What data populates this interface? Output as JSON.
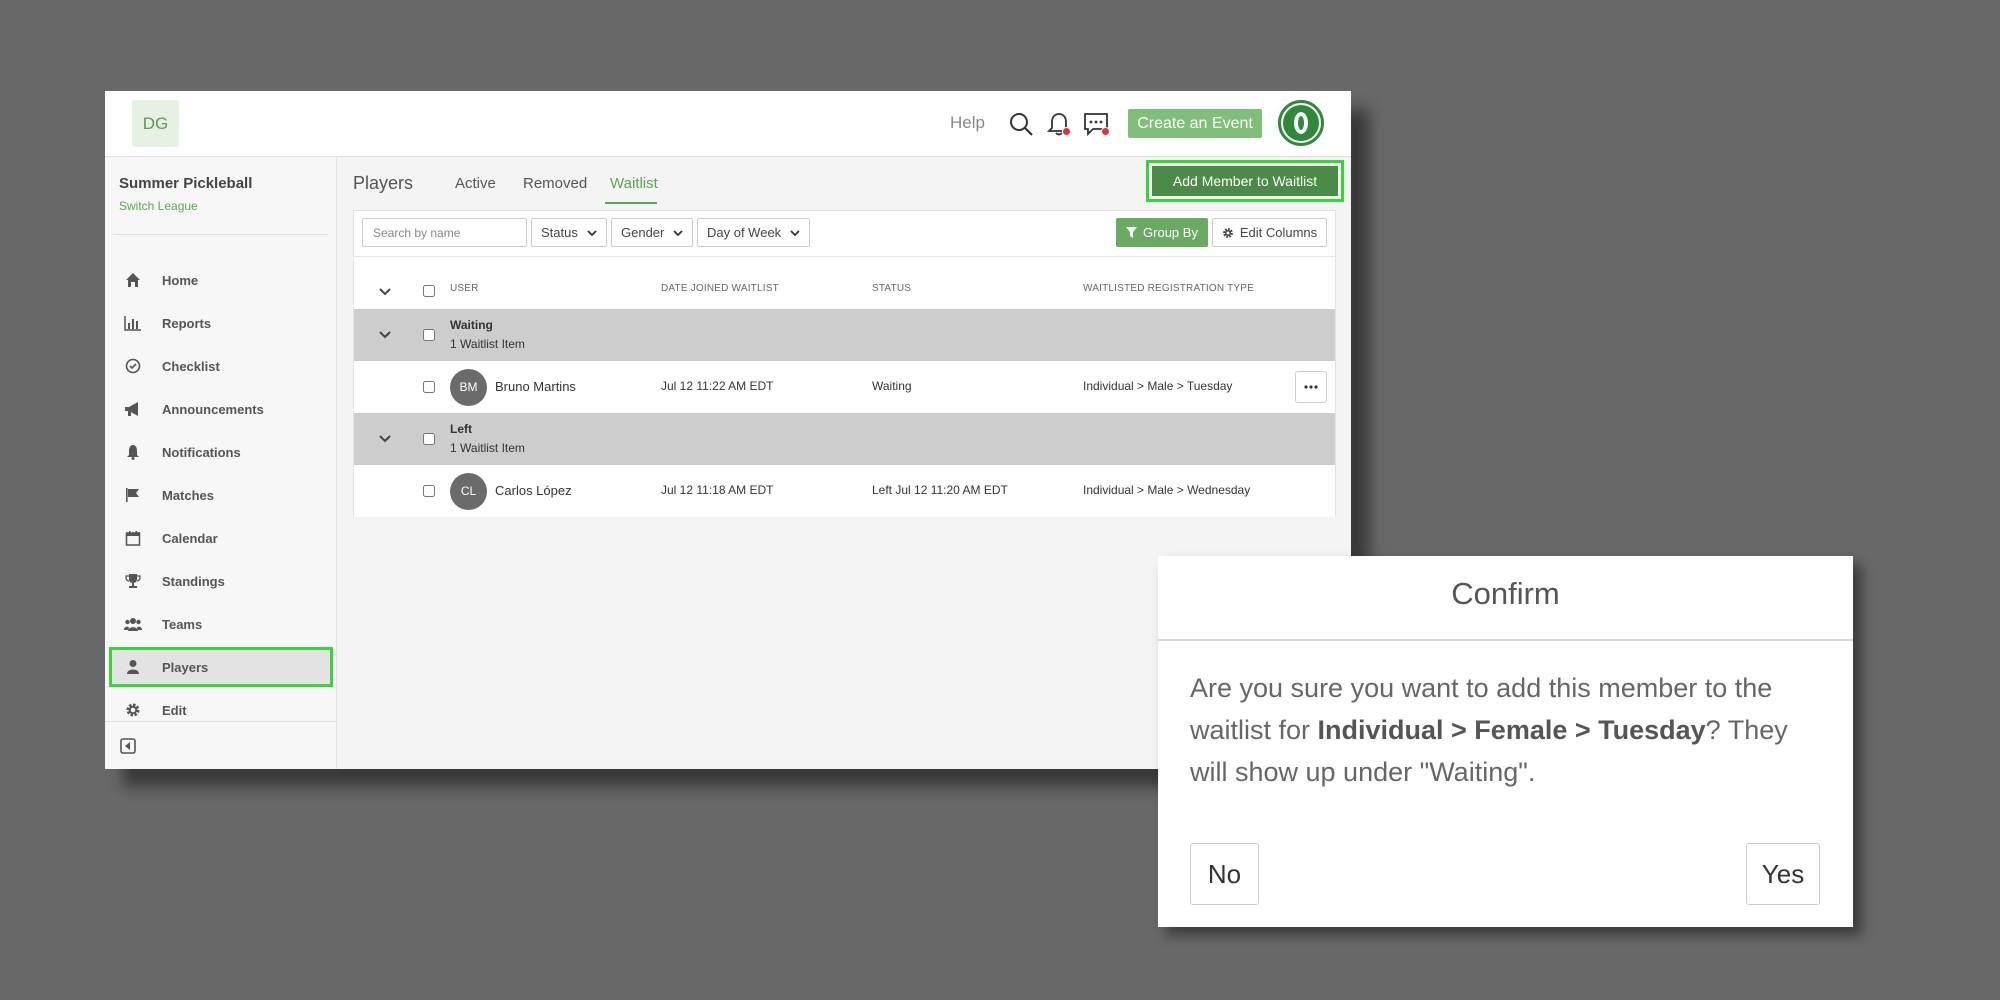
{
  "topbar": {
    "logo_initials": "DG",
    "help_label": "Help",
    "create_event_label": "Create an Event"
  },
  "sidebar": {
    "league_name": "Summer Pickleball",
    "switch_league_label": "Switch League",
    "items": [
      {
        "label": "Home",
        "icon": "home-icon"
      },
      {
        "label": "Reports",
        "icon": "bar-chart-icon"
      },
      {
        "label": "Checklist",
        "icon": "check-circle-icon"
      },
      {
        "label": "Announcements",
        "icon": "megaphone-icon"
      },
      {
        "label": "Notifications",
        "icon": "bell-icon"
      },
      {
        "label": "Matches",
        "icon": "flag-icon"
      },
      {
        "label": "Calendar",
        "icon": "calendar-icon"
      },
      {
        "label": "Standings",
        "icon": "trophy-icon"
      },
      {
        "label": "Teams",
        "icon": "users-icon"
      },
      {
        "label": "Players",
        "icon": "user-icon"
      },
      {
        "label": "Edit",
        "icon": "gear-icon"
      }
    ],
    "active_item": "Players"
  },
  "main": {
    "title": "Players",
    "tabs": [
      "Active",
      "Removed",
      "Waitlist"
    ],
    "active_tab": "Waitlist",
    "add_member_label": "Add Member to Waitlist",
    "search_placeholder": "Search by name",
    "filters": [
      "Status",
      "Gender",
      "Day of Week"
    ],
    "group_by_label": "Group By",
    "edit_columns_label": "Edit Columns",
    "columns": [
      "USER",
      "DATE JOINED WAITLIST",
      "STATUS",
      "WAITLISTED REGISTRATION TYPE"
    ],
    "groups": [
      {
        "title": "Waiting",
        "count_label": "1 Waitlist Item",
        "rows": [
          {
            "initials": "BM",
            "name": "Bruno Martins",
            "date_joined": "Jul 12 11:22 AM EDT",
            "status": "Waiting",
            "registration_type": "Individual > Male > Tuesday"
          }
        ]
      },
      {
        "title": "Left",
        "count_label": "1 Waitlist Item",
        "rows": [
          {
            "initials": "CL",
            "name": "Carlos López",
            "date_joined": "Jul 12 11:18 AM EDT",
            "status": "Left Jul 12 11:20 AM EDT",
            "registration_type": "Individual > Male > Wednesday"
          }
        ]
      }
    ]
  },
  "dialog": {
    "title": "Confirm",
    "body_prefix": "Are you sure you want to add this member to the waitlist for ",
    "body_bold": "Individual > Female > Tuesday",
    "body_suffix": "? They will show up under \"Waiting\".",
    "no_label": "No",
    "yes_label": "Yes"
  },
  "colors": {
    "accent_green": "#5aa653",
    "highlight_outline": "#37d637",
    "primary_button": "#4c8a47",
    "notification_dot": "#e53030"
  }
}
